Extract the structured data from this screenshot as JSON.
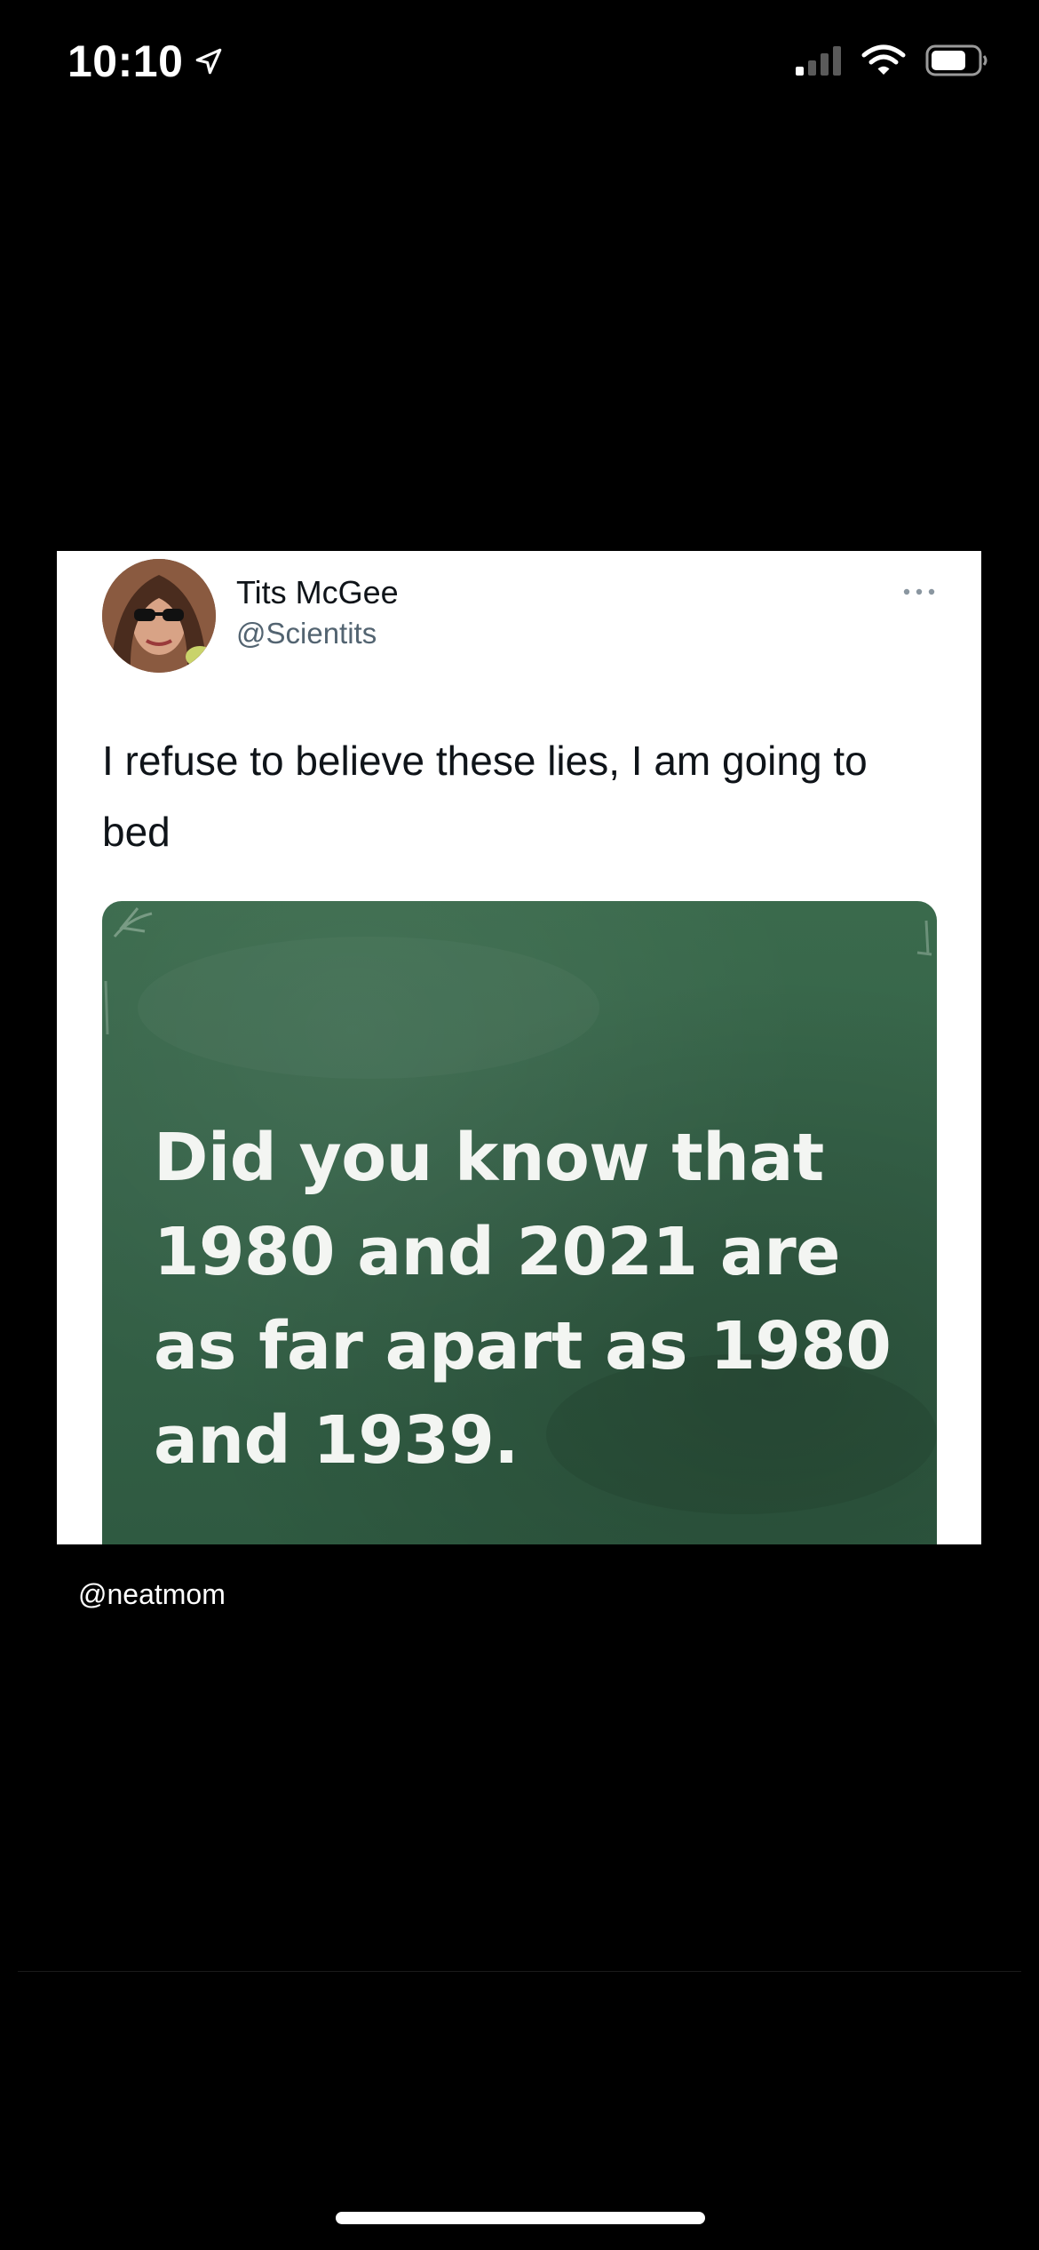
{
  "status_bar": {
    "time": "10:10",
    "location_icon": "location-arrow-icon",
    "signal_icon": "cellular-signal-icon",
    "wifi_icon": "wifi-icon",
    "battery_icon": "battery-icon"
  },
  "tweet": {
    "display_name": "Tits McGee",
    "handle": "@Scientits",
    "text": "I refuse to believe these lies, I am going to bed",
    "more_icon": "more-options-icon",
    "media_text": "Did you know that\n1980 and 2021 are\nas far apart as 1980\nand 1939."
  },
  "credit": "@neatmom",
  "colors": {
    "background": "#000000",
    "card": "#ffffff",
    "chalkboard": "#356248",
    "handle_gray": "#536471"
  }
}
